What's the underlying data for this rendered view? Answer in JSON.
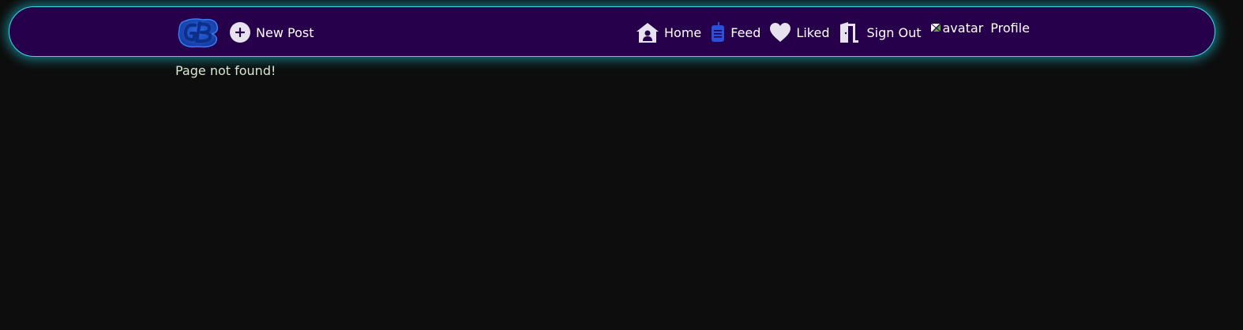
{
  "nav": {
    "new_post_label": "New Post",
    "items": [
      {
        "label": "Home",
        "icon": "home-icon"
      },
      {
        "label": "Feed",
        "icon": "feed-icon"
      },
      {
        "label": "Liked",
        "icon": "heart-icon"
      },
      {
        "label": "Sign Out",
        "icon": "door-icon"
      }
    ],
    "avatar_alt": "avatar",
    "profile_label": "Profile"
  },
  "main": {
    "message": "Page not found!"
  },
  "colors": {
    "background": "#0d0d0d",
    "navbar": "#26004a",
    "glow": "#3fd7e6",
    "logo": "#1e4fd0",
    "feed_icon": "#2b4fd8",
    "icon_light": "#e6e2ee"
  }
}
